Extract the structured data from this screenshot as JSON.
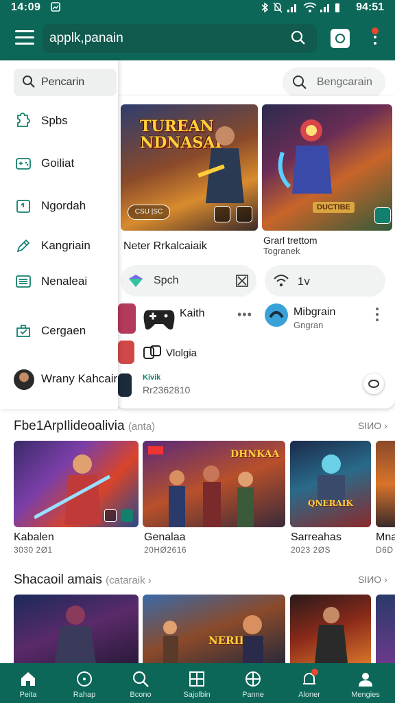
{
  "status_bar": {
    "time": "14:09",
    "system": "94:51"
  },
  "top_bar": {
    "search_value": "applk,panain"
  },
  "drawer": {
    "search_placeholder": "Pencarin",
    "items": [
      {
        "label": "Spbs",
        "icon": "puzzle-icon"
      },
      {
        "label": "Goiliat",
        "icon": "gamepad-icon"
      },
      {
        "label": "Ngordah",
        "icon": "calendar-icon"
      },
      {
        "label": "Kangriain",
        "icon": "edit-icon"
      },
      {
        "label": "Nenaleai",
        "icon": "list-icon"
      },
      {
        "label": "Cergaen",
        "icon": "inbox-icon"
      },
      {
        "label": "Wrany Kahcair",
        "icon": "avatar"
      }
    ]
  },
  "right_search": {
    "placeholder": "Bengcarain"
  },
  "featured": [
    {
      "art_title": "TUREAN NDNASAI",
      "badge": "CSU |SC",
      "caption": "Neter Rrkalcaiaik"
    },
    {
      "art_title": "DUCTIBE",
      "caption": "Grarl trettom",
      "sub": "Togranek"
    }
  ],
  "chips": [
    {
      "label": "Spch"
    },
    {
      "label": "1ⅴ"
    }
  ],
  "app_rows": [
    {
      "title": "Kaith"
    },
    {
      "title": "Mibgrain",
      "sub": "Gngran"
    },
    {
      "title": "Vlolgia"
    },
    {
      "title": "Kivik",
      "sub": "Rr2362810"
    }
  ],
  "section1": {
    "title": "Fbe1ArpIlideoalivia",
    "title_muted": "(anta)",
    "more": "SIИO ›",
    "tiles": [
      {
        "title": "Kabalen",
        "sub": "3030 2Ø1"
      },
      {
        "title": "Genalaa",
        "sub": "20HØ2616",
        "logo": "DHNKAA"
      },
      {
        "title": "Sarreahas",
        "sub": "2023 2ØS",
        "logo": "QNERAIK"
      },
      {
        "title": "Mna",
        "sub": "D6D"
      }
    ]
  },
  "section2": {
    "title": "Shacaoil amais",
    "title_muted": "(cataraik ›",
    "more": "SIИO ›",
    "tiles": [
      {},
      {
        "logo": "NERIBUS"
      },
      {},
      {}
    ]
  },
  "bottom_nav": [
    {
      "label": "Peita",
      "icon": "home-icon"
    },
    {
      "label": "Rahap",
      "icon": "compass-icon"
    },
    {
      "label": "Bcono",
      "icon": "search-icon"
    },
    {
      "label": "Sajolbin",
      "icon": "grid-icon"
    },
    {
      "label": "Panne",
      "icon": "globe-icon"
    },
    {
      "label": "Aloner",
      "icon": "bell-icon"
    },
    {
      "label": "Mengies",
      "icon": "profile-icon"
    }
  ],
  "colors": {
    "primary": "#0c6758",
    "accent": "#12806d",
    "badge": "#e8482e"
  }
}
